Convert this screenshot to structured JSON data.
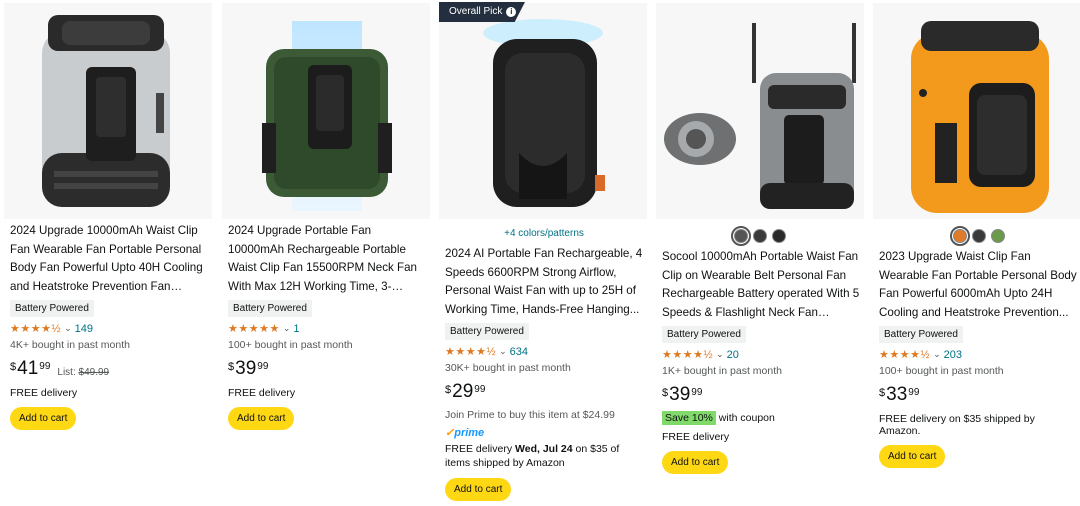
{
  "overall_pick": "Overall Pick",
  "products": [
    {
      "title": "2024 Upgrade 10000mAh Waist Clip Fan Wearable Fan Portable Personal Body Fan Powerful Upto 40H Cooling and Heatstroke Prevention Fan (Gray...",
      "badge": "Battery Powered",
      "stars": "★★★★½",
      "reviews": "149",
      "bought": "4K+ bought in past month",
      "price_symbol": "$",
      "price_whole": "41",
      "price_fraction": "99",
      "list_label": "List:",
      "list_price": "$49.99",
      "delivery": "FREE delivery",
      "cart": "Add to cart"
    },
    {
      "title": "2024 Upgrade Portable Fan 10000mAh Rechargeable Portable Waist Clip Fan 15500RPM Neck Fan With Max 12H Working Time, 3-spee...",
      "badge": "Battery Powered",
      "stars": "★★★★★",
      "reviews": "1",
      "bought": "100+ bought in past month",
      "price_symbol": "$",
      "price_whole": "39",
      "price_fraction": "99",
      "delivery": "FREE delivery",
      "cart": "Add to cart"
    },
    {
      "colors_link": "+4 colors/patterns",
      "title": "2024 AI Portable Fan Rechargeable, 4 Speeds 6600RPM Strong Airflow, Personal Waist Fan with up to 25H of Working Time, Hands-Free Hanging...",
      "badge": "Battery Powered",
      "stars": "★★★★½",
      "reviews": "634",
      "bought": "30K+ bought in past month",
      "price_symbol": "$",
      "price_whole": "29",
      "price_fraction": "99",
      "prime_offer": "Join Prime to buy this item at $24.99",
      "prime_logo": "prime",
      "delivery_prefix": "FREE delivery ",
      "delivery_date": "Wed, Jul 24",
      "delivery_suffix": " on $35 of items shipped by Amazon",
      "cart": "Add to cart"
    },
    {
      "swatch_colors": [
        "#555555",
        "#3a3a3a",
        "#2b2b2b"
      ],
      "title": "Socool 10000mAh Portable Waist Fan Clip on Wearable Belt Personal Fan Rechargeable Battery operated With 5 Speeds & Flashlight Neck Fan Hands-...",
      "badge": "Battery Powered",
      "stars": "★★★★½",
      "reviews": "20",
      "bought": "1K+ bought in past month",
      "price_symbol": "$",
      "price_whole": "39",
      "price_fraction": "99",
      "save_badge": "Save 10%",
      "save_text": "with coupon",
      "delivery": "FREE delivery",
      "cart": "Add to cart"
    },
    {
      "swatch_colors": [
        "#e07b2a",
        "#3a3a3a",
        "#6a9a4a"
      ],
      "title": "2023 Upgrade Waist Clip Fan Wearable Fan Portable Personal Body Fan Powerful 6000mAh Upto 24H Cooling and Heatstroke Prevention...",
      "badge": "Battery Powered",
      "stars": "★★★★½",
      "reviews": "203",
      "bought": "100+ bought in past month",
      "price_symbol": "$",
      "price_whole": "33",
      "price_fraction": "99",
      "delivery": "FREE delivery on $35 shipped by Amazon.",
      "cart": "Add to cart"
    }
  ],
  "icons": [
    "info-icon",
    "chevron-down-icon",
    "star-icon"
  ],
  "colors": {
    "cart_button": "#ffd814",
    "star": "#de7921",
    "link": "#007185",
    "save_badge": "#7fda69",
    "overall_pick_bg": "#232f3e",
    "prime": "#1399ff"
  }
}
